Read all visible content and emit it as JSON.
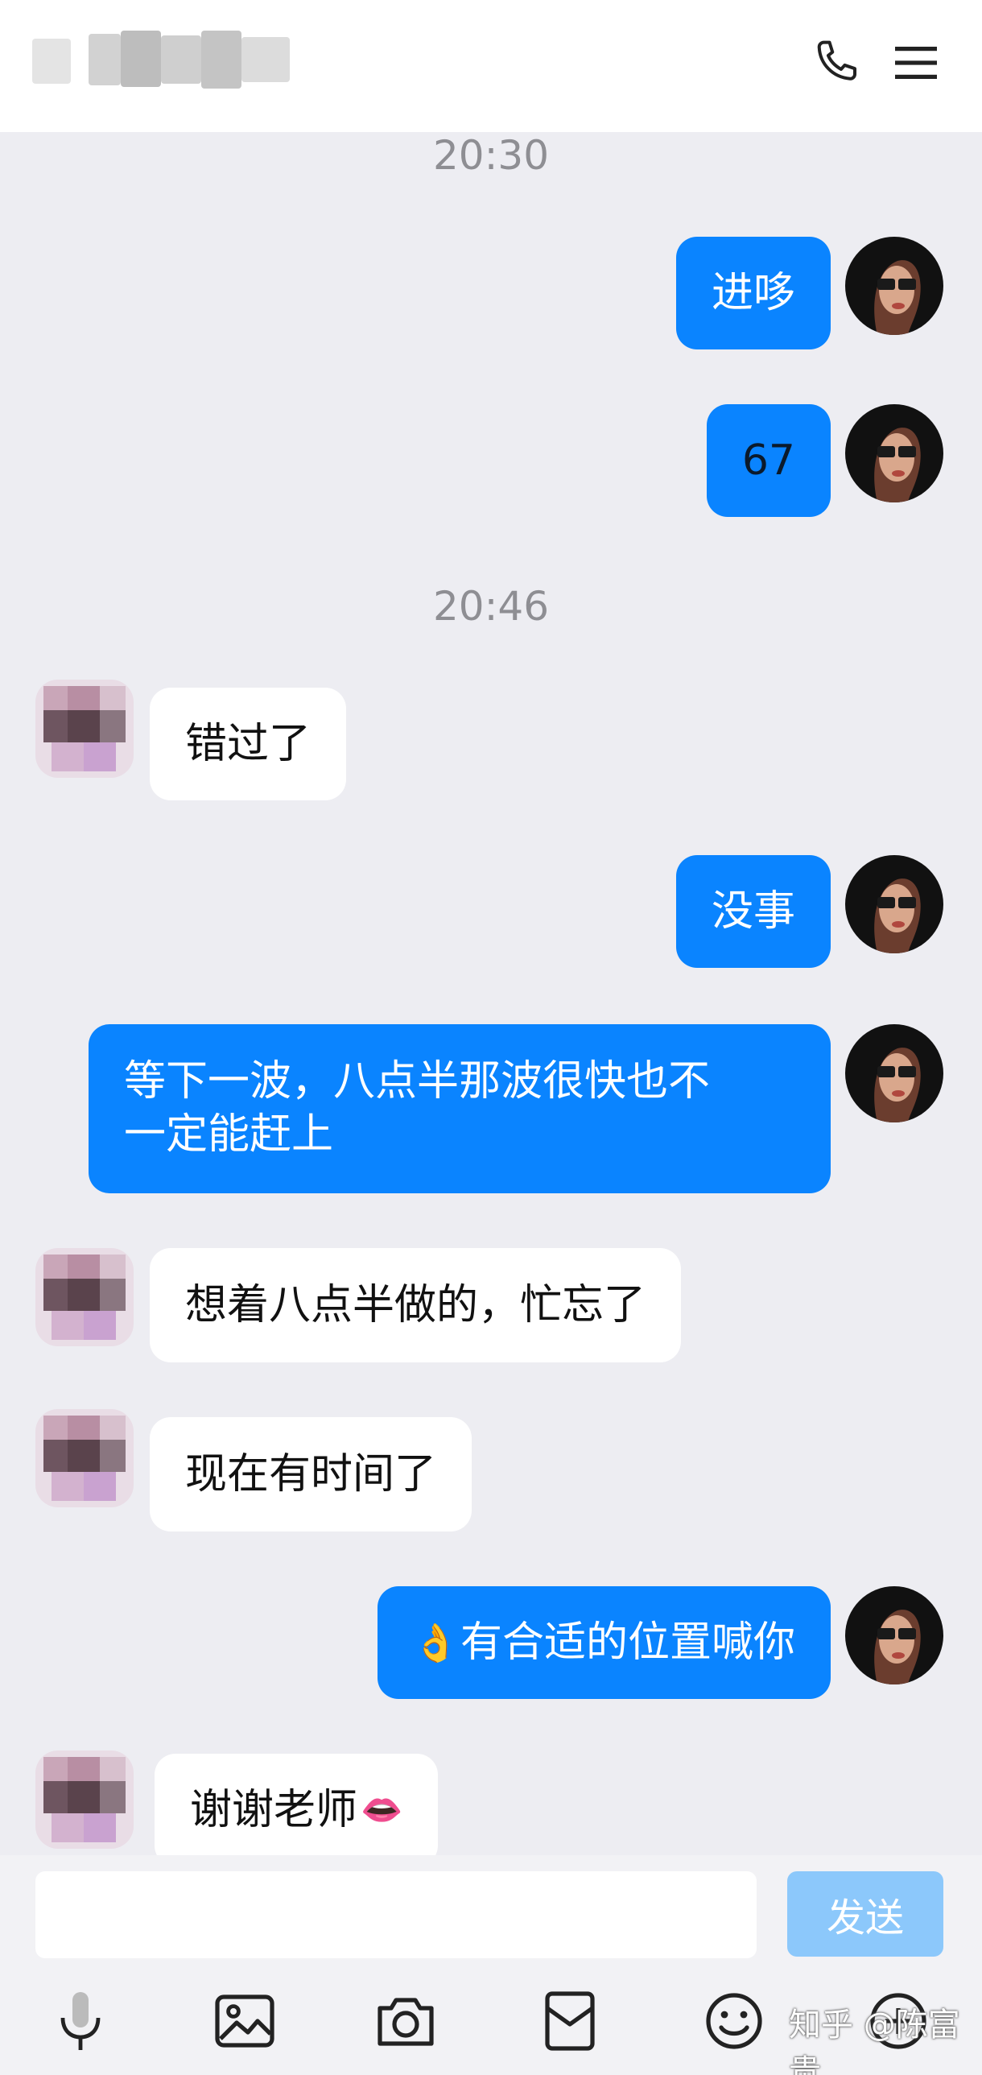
{
  "header": {
    "contact_name_hidden": "",
    "icons": [
      "phone-icon",
      "menu-icon"
    ]
  },
  "messages": [
    {
      "type": "timestamp",
      "text": "20:30"
    },
    {
      "type": "mine",
      "text": "进哆"
    },
    {
      "type": "mine",
      "text": "67"
    },
    {
      "type": "timestamp",
      "text": "20:46"
    },
    {
      "type": "other",
      "text": "错过了"
    },
    {
      "type": "mine",
      "text": "没事"
    },
    {
      "type": "mine",
      "line1": "等下一波，八点半那波很快也不",
      "line2": "一定能赶上"
    },
    {
      "type": "other",
      "text": "想着八点半做的，忙忘了"
    },
    {
      "type": "other",
      "text": "现在有时间了"
    },
    {
      "type": "mine",
      "emoji": "👌",
      "text": "有合适的位置喊你"
    },
    {
      "type": "other",
      "text": "谢谢老师",
      "emoji": "👄"
    }
  ],
  "composer": {
    "placeholder": "",
    "send_label": "发送"
  },
  "toolbar": [
    "microphone-icon",
    "image-icon",
    "camera-icon",
    "red-packet-icon",
    "emoji-icon",
    "plus-icon"
  ],
  "watermark": "知乎 @陈富贵",
  "colors": {
    "my_bubble": "#0a84ff",
    "other_bubble": "#ffffff",
    "background": "#ededf2",
    "send_button_disabled": "#8cc8fb"
  }
}
